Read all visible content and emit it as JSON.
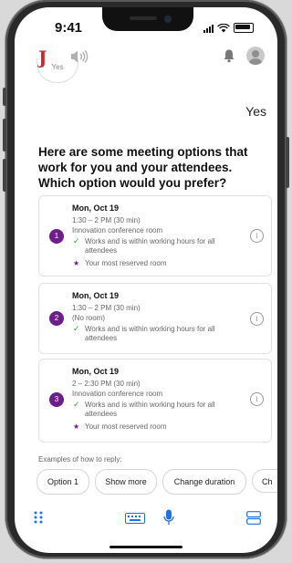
{
  "status": {
    "time": "9:41"
  },
  "app": {
    "logo": "J"
  },
  "conversation": {
    "previous_bubble": "Yes",
    "user_reply": "Yes",
    "question": "Here are some meeting options that work for you and your attendees. Which option would you prefer?"
  },
  "options": [
    {
      "number": "1",
      "date": "Mon, Oct 19",
      "time": "1:30 – 2 PM (30 min)",
      "room": "Innovation conference room",
      "check": "Works and is within working hours for all attendees",
      "star": "Your most reserved room"
    },
    {
      "number": "2",
      "date": "Mon, Oct 19",
      "time": "1:30 – 2 PM (30 min)",
      "room": "(No room)",
      "check": "Works and is within working hours for all attendees",
      "star": ""
    },
    {
      "number": "3",
      "date": "Mon, Oct 19",
      "time": "2 – 2:30 PM (30 min)",
      "room": "Innovation conference room",
      "check": "Works and is within working hours for all attendees",
      "star": "Your most reserved room"
    }
  ],
  "examples": {
    "label": "Examples of how to reply:",
    "chips": [
      "Option 1",
      "Show more",
      "Change duration",
      "Ch"
    ]
  },
  "colors": {
    "accent": "#6d1e8a",
    "logo": "#d3222a",
    "check": "#2e9e44",
    "mic": "#1a73e8"
  },
  "icons": [
    "speaker-icon",
    "bell-icon",
    "avatar",
    "grid-dots-icon",
    "keyboard-icon",
    "microphone-icon",
    "layout-toggle-icon",
    "info-icon",
    "checkmark-icon",
    "star-icon"
  ]
}
